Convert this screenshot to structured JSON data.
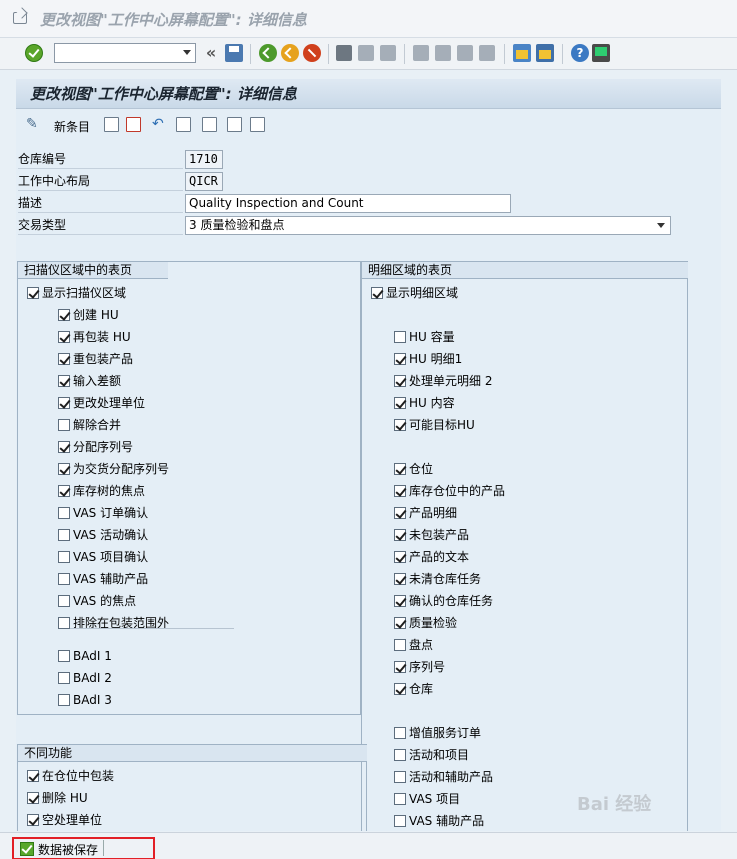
{
  "title_bar": {
    "text": "更改视图\"工作中心屏幕配置\": 详细信息"
  },
  "toolbar": {
    "command_field_value": "",
    "back_arrows": "«"
  },
  "panel": {
    "header": "更改视图\"工作中心屏幕配置\": 详细信息",
    "new_entries_label": "新条目"
  },
  "form": {
    "fields": [
      {
        "label": "仓库编号",
        "value": "1710"
      },
      {
        "label": "工作中心布局",
        "value": "QICR"
      },
      {
        "label": "描述",
        "value": "Quality Inspection and Count"
      },
      {
        "label": "交易类型",
        "value": "3 质量检验和盘点"
      }
    ]
  },
  "scanner_box": {
    "title": "扫描仪区域中的表页",
    "main": {
      "label": "显示扫描仪区域",
      "checked": true
    },
    "items": [
      {
        "label": "创建 HU",
        "checked": true
      },
      {
        "label": "再包装 HU",
        "checked": true
      },
      {
        "label": "重包装产品",
        "checked": true
      },
      {
        "label": "输入差额",
        "checked": true
      },
      {
        "label": "更改处理单位",
        "checked": true
      },
      {
        "label": "解除合并",
        "checked": false
      },
      {
        "label": "分配序列号",
        "checked": true
      },
      {
        "label": "为交货分配序列号",
        "checked": true
      },
      {
        "label": "库存树的焦点",
        "checked": true
      },
      {
        "label": "VAS 订单确认",
        "checked": false
      },
      {
        "label": "VAS 活动确认",
        "checked": false
      },
      {
        "label": "VAS 项目确认",
        "checked": false
      },
      {
        "label": "VAS 辅助产品",
        "checked": false
      },
      {
        "label": "VAS 的焦点",
        "checked": false
      },
      {
        "label": "排除在包装范围外",
        "checked": false
      },
      {
        "label": "BAdI 1",
        "checked": false
      },
      {
        "label": "BAdI 2",
        "checked": false
      },
      {
        "label": "BAdI 3",
        "checked": false
      }
    ]
  },
  "detail_box": {
    "title": "明细区域的表页",
    "main": {
      "label": "显示明细区域",
      "checked": true
    },
    "group1": [
      {
        "label": "HU 容量",
        "checked": false
      },
      {
        "label": "HU 明细1",
        "checked": true
      },
      {
        "label": "处理单元明细 2",
        "checked": true
      },
      {
        "label": "HU 内容",
        "checked": true
      },
      {
        "label": "可能目标HU",
        "checked": true
      }
    ],
    "group2": [
      {
        "label": "仓位",
        "checked": true
      },
      {
        "label": "库存仓位中的产品",
        "checked": true
      },
      {
        "label": "产品明细",
        "checked": true
      },
      {
        "label": "未包装产品",
        "checked": true
      },
      {
        "label": "产品的文本",
        "checked": true
      },
      {
        "label": "未清仓库任务",
        "checked": true
      },
      {
        "label": "确认的仓库任务",
        "checked": true
      },
      {
        "label": "质量检验",
        "checked": true
      },
      {
        "label": "盘点",
        "checked": false
      },
      {
        "label": "序列号",
        "checked": true
      },
      {
        "label": "仓库",
        "checked": true
      }
    ],
    "group3": [
      {
        "label": "增值服务订单",
        "checked": false
      },
      {
        "label": "活动和项目",
        "checked": false
      },
      {
        "label": "活动和辅助产品",
        "checked": false
      },
      {
        "label": "VAS 项目",
        "checked": false
      },
      {
        "label": "VAS 辅助产品",
        "checked": false
      }
    ]
  },
  "misc_box": {
    "title": "不同功能",
    "items": [
      {
        "label": "在仓位中包装",
        "checked": true
      },
      {
        "label": "删除 HU",
        "checked": true
      },
      {
        "label": "空处理单位",
        "checked": true
      }
    ]
  },
  "status_bar": {
    "message": "数据被保存"
  },
  "watermark": {
    "text": "Bai 经验"
  }
}
